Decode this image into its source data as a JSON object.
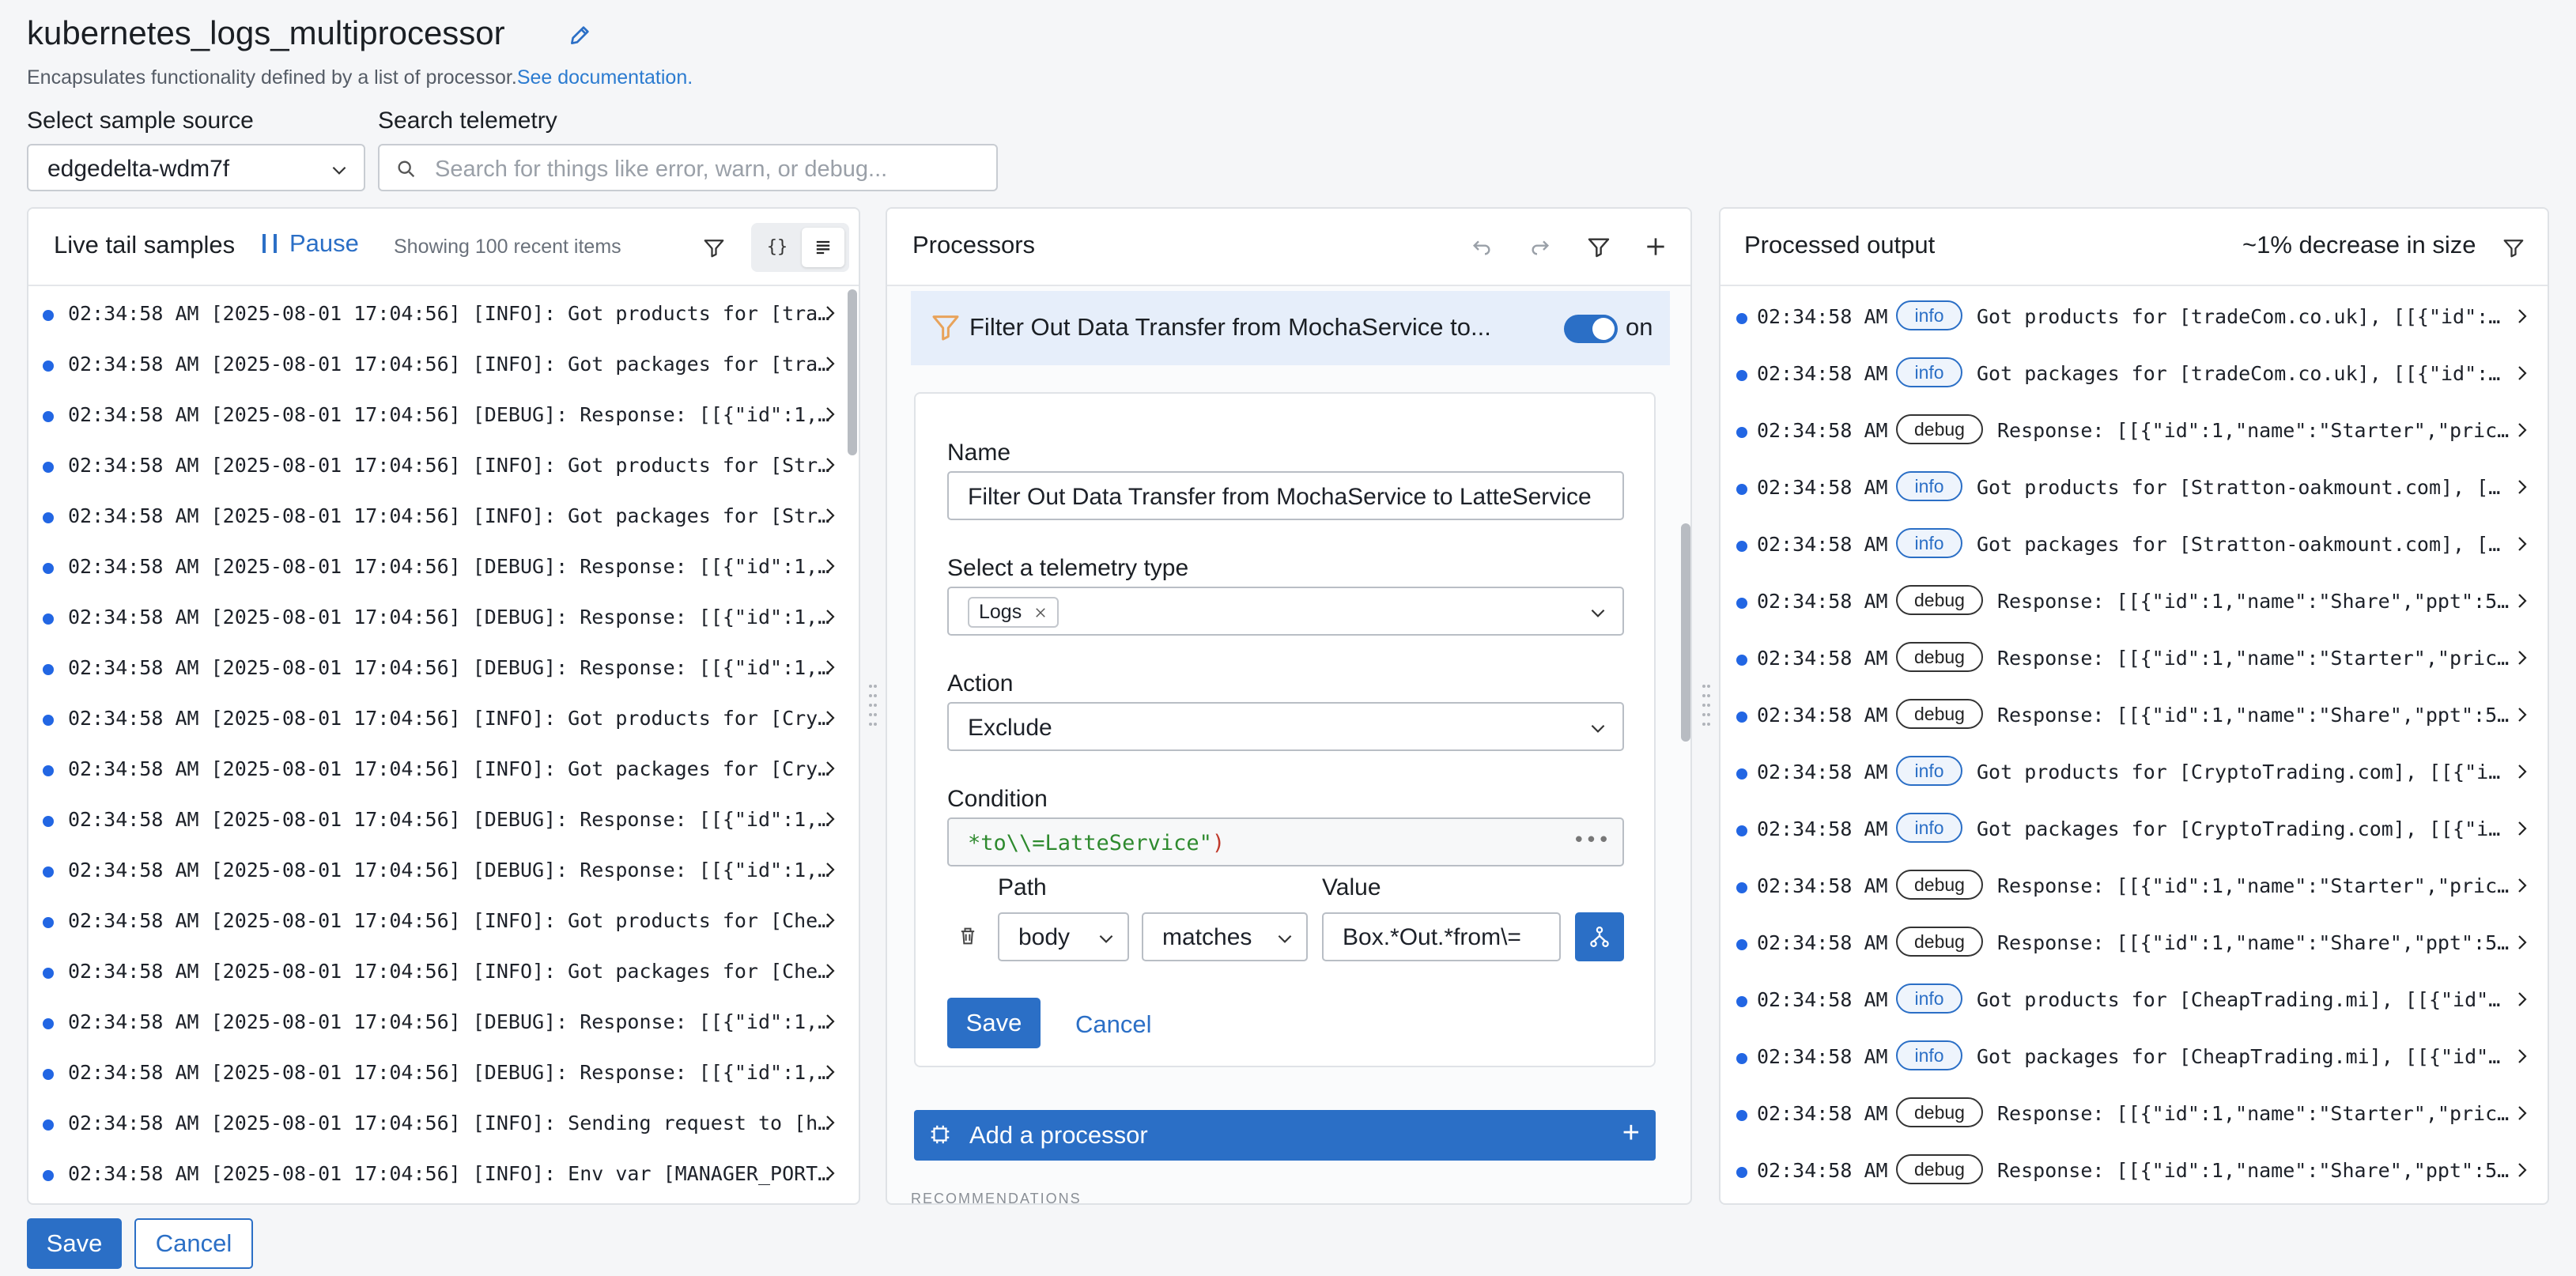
{
  "header": {
    "title": "kubernetes_logs_multiprocessor",
    "subtitle": "Encapsulates functionality defined by a list of processor.",
    "docs_link": "See documentation."
  },
  "filters": {
    "source_label": "Select sample source",
    "source_value": "edgedelta-wdm7f",
    "search_label": "Search telemetry",
    "search_placeholder": "Search for things like error, warn, or debug..."
  },
  "live_tail": {
    "title": "Live tail samples",
    "pause_label": "Pause",
    "showing": "Showing 100 recent items",
    "json_toggle": "{}",
    "rows": [
      "02:34:58 AM [2025-08-01 17:04:56] [INFO]: Got products for [tra…",
      "02:34:58 AM [2025-08-01 17:04:56] [INFO]: Got packages for [tra…",
      "02:34:58 AM [2025-08-01 17:04:56] [DEBUG]: Response: [[{\"id\":1,…",
      "02:34:58 AM [2025-08-01 17:04:56] [INFO]: Got products for [Str…",
      "02:34:58 AM [2025-08-01 17:04:56] [INFO]: Got packages for [Str…",
      "02:34:58 AM [2025-08-01 17:04:56] [DEBUG]: Response: [[{\"id\":1,…",
      "02:34:58 AM [2025-08-01 17:04:56] [DEBUG]: Response: [[{\"id\":1,…",
      "02:34:58 AM [2025-08-01 17:04:56] [DEBUG]: Response: [[{\"id\":1,…",
      "02:34:58 AM [2025-08-01 17:04:56] [INFO]: Got products for [Cry…",
      "02:34:58 AM [2025-08-01 17:04:56] [INFO]: Got packages for [Cry…",
      "02:34:58 AM [2025-08-01 17:04:56] [DEBUG]: Response: [[{\"id\":1,…",
      "02:34:58 AM [2025-08-01 17:04:56] [DEBUG]: Response: [[{\"id\":1,…",
      "02:34:58 AM [2025-08-01 17:04:56] [INFO]: Got products for [Che…",
      "02:34:58 AM [2025-08-01 17:04:56] [INFO]: Got packages for [Che…",
      "02:34:58 AM [2025-08-01 17:04:56] [DEBUG]: Response: [[{\"id\":1,…",
      "02:34:58 AM [2025-08-01 17:04:56] [DEBUG]: Response: [[{\"id\":1,…",
      "02:34:58 AM [2025-08-01 17:04:56] [INFO]: Sending request to [h…",
      "02:34:58 AM [2025-08-01 17:04:56] [INFO]: Env var [MANAGER_PORT…"
    ]
  },
  "processors": {
    "title": "Processors",
    "item_label": "Filter Out Data Transfer from MochaService to...",
    "switch_label": "on",
    "form": {
      "name_label": "Name",
      "name_value": "Filter Out Data Transfer from MochaService to LatteService",
      "telemetry_label": "Select a telemetry type",
      "telemetry_chip": "Logs",
      "action_label": "Action",
      "action_value": "Exclude",
      "condition_label": "Condition",
      "condition_code": "*to\\\\=LatteService\"",
      "condition_paren": ")",
      "path_label": "Path",
      "path_value": "body",
      "operator_value": "matches",
      "value_label": "Value",
      "value_value": "Box.*Out.*from\\=",
      "save": "Save",
      "cancel": "Cancel"
    },
    "add_label": "Add a processor",
    "recommendations_label": "RECOMMENDATIONS"
  },
  "output": {
    "title": "Processed output",
    "size_note": "~1% decrease in size",
    "rows": [
      {
        "time": "02:34:58 AM",
        "level": "info",
        "msg": "Got products for [tradeCom.co.uk], [[{\"id\":…"
      },
      {
        "time": "02:34:58 AM",
        "level": "info",
        "msg": "Got packages for [tradeCom.co.uk], [[{\"id\":…"
      },
      {
        "time": "02:34:58 AM",
        "level": "debug",
        "msg": "Response: [[{\"id\":1,\"name\":\"Starter\",\"pric…"
      },
      {
        "time": "02:34:58 AM",
        "level": "info",
        "msg": "Got products for [Stratton-oakmount.com], […"
      },
      {
        "time": "02:34:58 AM",
        "level": "info",
        "msg": "Got packages for [Stratton-oakmount.com], […"
      },
      {
        "time": "02:34:58 AM",
        "level": "debug",
        "msg": "Response: [[{\"id\":1,\"name\":\"Share\",\"ppt\":5…"
      },
      {
        "time": "02:34:58 AM",
        "level": "debug",
        "msg": "Response: [[{\"id\":1,\"name\":\"Starter\",\"pric…"
      },
      {
        "time": "02:34:58 AM",
        "level": "debug",
        "msg": "Response: [[{\"id\":1,\"name\":\"Share\",\"ppt\":5…"
      },
      {
        "time": "02:34:58 AM",
        "level": "info",
        "msg": "Got products for [CryptoTrading.com], [[{\"i…"
      },
      {
        "time": "02:34:58 AM",
        "level": "info",
        "msg": "Got packages for [CryptoTrading.com], [[{\"i…"
      },
      {
        "time": "02:34:58 AM",
        "level": "debug",
        "msg": "Response: [[{\"id\":1,\"name\":\"Starter\",\"pric…"
      },
      {
        "time": "02:34:58 AM",
        "level": "debug",
        "msg": "Response: [[{\"id\":1,\"name\":\"Share\",\"ppt\":5…"
      },
      {
        "time": "02:34:58 AM",
        "level": "info",
        "msg": "Got products for [CheapTrading.mi], [[{\"id\"…"
      },
      {
        "time": "02:34:58 AM",
        "level": "info",
        "msg": "Got packages for [CheapTrading.mi], [[{\"id\"…"
      },
      {
        "time": "02:34:58 AM",
        "level": "debug",
        "msg": "Response: [[{\"id\":1,\"name\":\"Starter\",\"pric…"
      },
      {
        "time": "02:34:58 AM",
        "level": "debug",
        "msg": "Response: [[{\"id\":1,\"name\":\"Share\",\"ppt\":5…"
      }
    ]
  },
  "footer": {
    "save": "Save",
    "cancel": "Cancel"
  },
  "colors": {
    "accent": "#2b6fc6",
    "dot": "#2266e3",
    "selected_bg": "#e6eefa"
  }
}
